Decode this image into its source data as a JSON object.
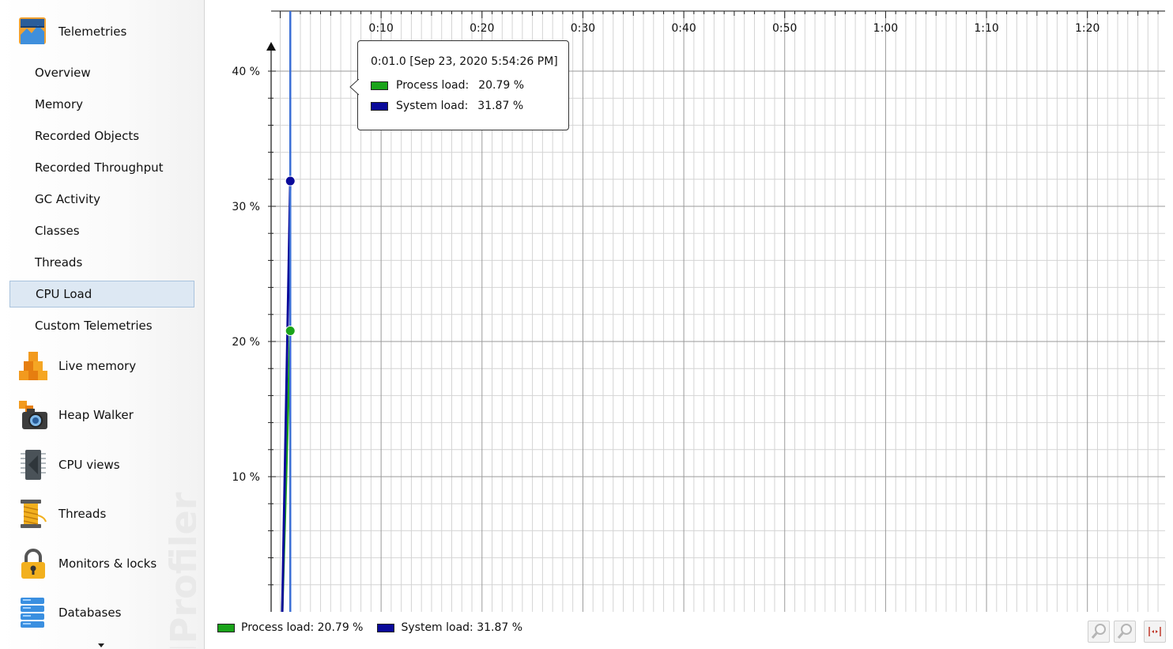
{
  "sidebar": {
    "telemetries": {
      "label": "Telemetries",
      "items": [
        {
          "label": "Overview"
        },
        {
          "label": "Memory"
        },
        {
          "label": "Recorded Objects"
        },
        {
          "label": "Recorded Throughput"
        },
        {
          "label": "GC Activity"
        },
        {
          "label": "Classes"
        },
        {
          "label": "Threads"
        },
        {
          "label": "CPU Load",
          "selected": true
        },
        {
          "label": "Custom Telemetries"
        }
      ]
    },
    "sections": [
      {
        "label": "Live memory",
        "icon": "live-memory-icon"
      },
      {
        "label": "Heap Walker",
        "icon": "heap-walker-icon"
      },
      {
        "label": "CPU views",
        "icon": "cpu-views-icon"
      },
      {
        "label": "Threads",
        "icon": "threads-icon"
      },
      {
        "label": "Monitors & locks",
        "icon": "monitors-locks-icon"
      },
      {
        "label": "Databases",
        "icon": "databases-icon"
      }
    ],
    "watermark": "JProfiler"
  },
  "tooltip": {
    "title": "0:01.0 [Sep 23, 2020 5:54:26 PM]",
    "rows": [
      {
        "label": "Process load:",
        "value": "20.79 %",
        "color": "#1aa31a"
      },
      {
        "label": "System load:",
        "value": "31.87 %",
        "color": "#0a0a9a"
      }
    ]
  },
  "legend": [
    {
      "text": "Process load: 20.79 %",
      "color": "#1aa31a"
    },
    {
      "text": "System load: 31.87 %",
      "color": "#0a0a9a"
    }
  ],
  "chart_data": {
    "type": "line",
    "x_tick_labels": [
      "0:10",
      "0:20",
      "0:30",
      "0:40",
      "0:50",
      "1:00",
      "1:10",
      "1:20"
    ],
    "x_ticks_seconds": [
      10,
      20,
      30,
      40,
      50,
      60,
      70,
      80
    ],
    "y_tick_labels": [
      "10 %",
      "20 %",
      "30 %",
      "40 %"
    ],
    "y_ticks": [
      10,
      20,
      30,
      40
    ],
    "xlim_seconds": [
      -0.9,
      87.7
    ],
    "ylim": [
      0,
      40
    ],
    "grid": true,
    "cursor_time_seconds": 1.0,
    "series": [
      {
        "name": "Process load",
        "color": "#1aa31a",
        "points": [
          [
            0.2,
            0
          ],
          [
            1.0,
            20.79
          ]
        ]
      },
      {
        "name": "System load",
        "color": "#0a0a9a",
        "points": [
          [
            0.2,
            0
          ],
          [
            1.0,
            31.87
          ]
        ]
      }
    ]
  },
  "colors": {
    "selection_bg": "#dde8f3",
    "cursor_line": "#3b6fd6",
    "grid_major": "#9a9a9a",
    "grid_minor": "#d4d4d4"
  }
}
